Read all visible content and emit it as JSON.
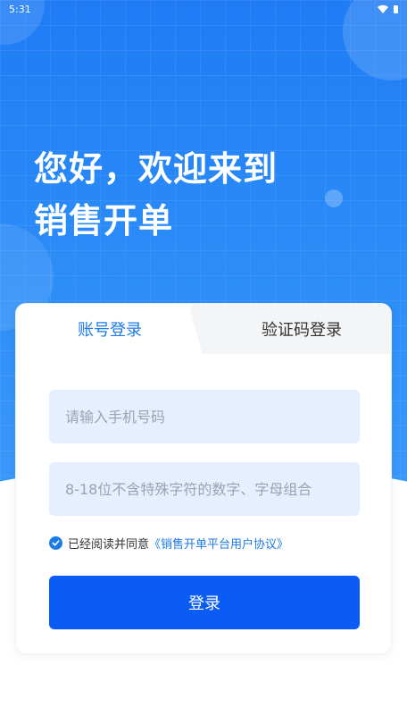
{
  "status_bar": {
    "time": "5:31"
  },
  "hero": {
    "line1": "您好，欢迎来到",
    "line2": "销售开单"
  },
  "tabs": {
    "account": "账号登录",
    "code": "验证码登录"
  },
  "form": {
    "phone_placeholder": "请输入手机号码",
    "password_placeholder": "8-18位不含特殊字符的数字、字母组合"
  },
  "agreement": {
    "prefix": "已经阅读并同意",
    "link": "《销售开单平台用户协议》"
  },
  "login_button": "登录",
  "colors": {
    "primary": "#0a5cf5",
    "accent": "#1e7be6",
    "hero": "#1f7cf5",
    "field_bg": "#e6efff"
  }
}
